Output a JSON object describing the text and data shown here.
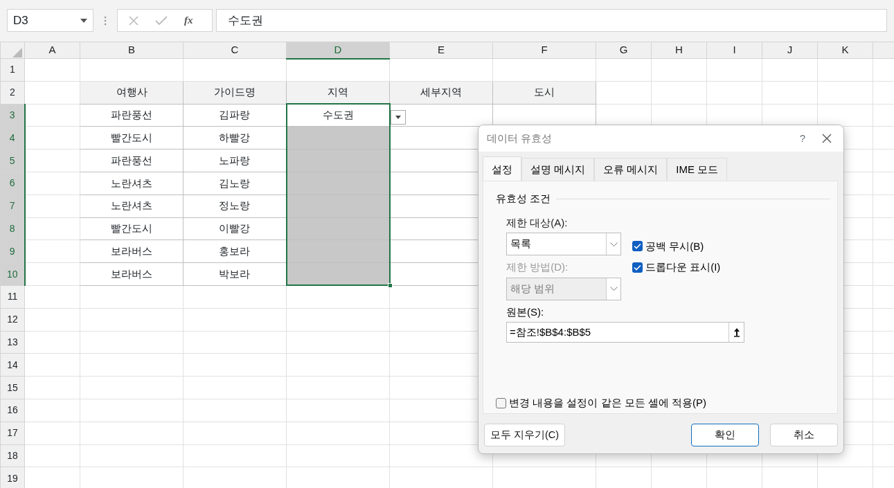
{
  "name_box": {
    "value": "D3"
  },
  "formula_bar": {
    "function_label": "fx",
    "value": "수도권"
  },
  "columns": [
    {
      "label": "A",
      "selected": false
    },
    {
      "label": "B",
      "selected": false
    },
    {
      "label": "C",
      "selected": false
    },
    {
      "label": "D",
      "selected": true
    },
    {
      "label": "E",
      "selected": false
    },
    {
      "label": "F",
      "selected": false
    },
    {
      "label": "G",
      "selected": false
    },
    {
      "label": "H",
      "selected": false
    },
    {
      "label": "I",
      "selected": false
    },
    {
      "label": "J",
      "selected": false
    },
    {
      "label": "K",
      "selected": false
    }
  ],
  "rows": [
    {
      "label": "1",
      "selected": false,
      "cells": []
    },
    {
      "label": "2",
      "selected": false,
      "cells": [
        "여행사",
        "가이드명",
        "지역",
        "세부지역",
        "도시"
      ]
    },
    {
      "label": "3",
      "selected": true,
      "cells": [
        "파란풍선",
        "김파랑",
        "수도권",
        "",
        ""
      ]
    },
    {
      "label": "4",
      "selected": true,
      "cells": [
        "빨간도시",
        "하빨강",
        "",
        "",
        ""
      ]
    },
    {
      "label": "5",
      "selected": true,
      "cells": [
        "파란풍선",
        "노파랑",
        "",
        "",
        ""
      ]
    },
    {
      "label": "6",
      "selected": true,
      "cells": [
        "노란셔츠",
        "김노랑",
        "",
        "",
        ""
      ]
    },
    {
      "label": "7",
      "selected": true,
      "cells": [
        "노란셔츠",
        "정노랑",
        "",
        "",
        ""
      ]
    },
    {
      "label": "8",
      "selected": true,
      "cells": [
        "빨간도시",
        "이빨강",
        "",
        "",
        ""
      ]
    },
    {
      "label": "9",
      "selected": true,
      "cells": [
        "보라버스",
        "홍보라",
        "",
        "",
        ""
      ]
    },
    {
      "label": "10",
      "selected": true,
      "cells": [
        "보라버스",
        "박보라",
        "",
        "",
        ""
      ]
    },
    {
      "label": "11",
      "selected": false,
      "cells": []
    },
    {
      "label": "12",
      "selected": false,
      "cells": []
    },
    {
      "label": "13",
      "selected": false,
      "cells": []
    },
    {
      "label": "14",
      "selected": false,
      "cells": []
    },
    {
      "label": "15",
      "selected": false,
      "cells": []
    },
    {
      "label": "16",
      "selected": false,
      "cells": []
    },
    {
      "label": "17",
      "selected": false,
      "cells": []
    },
    {
      "label": "18",
      "selected": false,
      "cells": []
    },
    {
      "label": "19",
      "selected": false,
      "cells": []
    }
  ],
  "in_cell_dropdown": true,
  "dialog": {
    "title": "데이터 유효성",
    "help": "?",
    "tabs": [
      {
        "label": "설정",
        "selected": true
      },
      {
        "label": "설명 메시지",
        "selected": false
      },
      {
        "label": "오류 메시지",
        "selected": false
      },
      {
        "label": "IME 모드",
        "selected": false
      }
    ],
    "group_title": "유효성 조건",
    "allow": {
      "label": "제한 대상(A):",
      "value": "목록",
      "disabled": false
    },
    "data": {
      "label": "제한 방법(D):",
      "value": "해당 범위",
      "disabled": true
    },
    "checkboxes": [
      {
        "label": "공백 무시(B)",
        "checked": true
      },
      {
        "label": "드롭다운 표시(I)",
        "checked": true
      }
    ],
    "source": {
      "label": "원본(S):",
      "value": "=참조!$B$4:$B$5"
    },
    "apply_all": {
      "label": "변경 내용을 설정이 같은 모든 셀에 적용(P)",
      "checked": false
    },
    "buttons": [
      {
        "label": "모두 지우기(C)",
        "kind": "left"
      },
      {
        "label": "확인",
        "kind": "default"
      },
      {
        "label": "취소",
        "kind": "normal"
      }
    ]
  }
}
